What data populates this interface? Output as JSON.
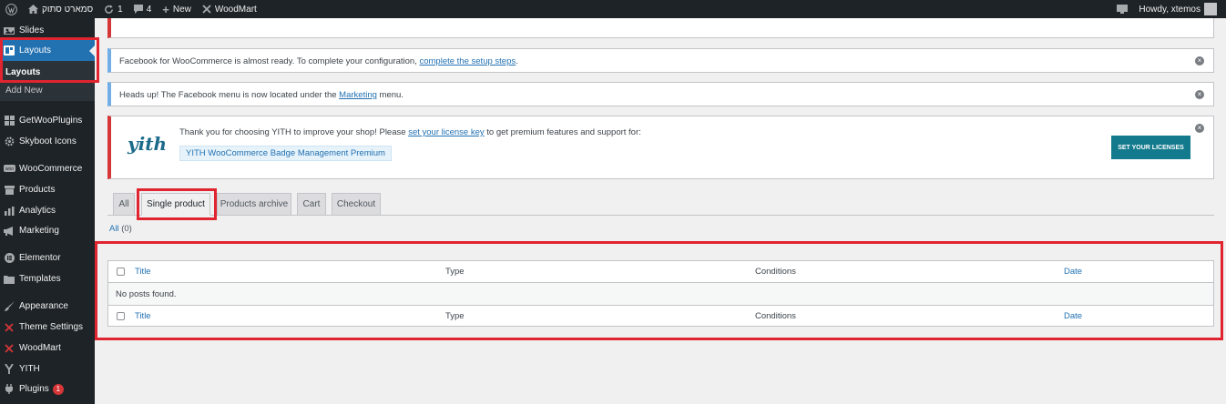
{
  "adminbar": {
    "site_name": "סמארט סתוק",
    "updates_count": "1",
    "comments_count": "4",
    "new_label": "New",
    "theme_label": "WoodMart",
    "greeting": "Howdy, xtemos"
  },
  "sidebar": {
    "items": [
      {
        "label": "Slides",
        "icon": "slides-icon"
      },
      {
        "label": "Layouts",
        "icon": "layouts-icon"
      },
      {
        "label": "GetWooPlugins",
        "icon": "plugin-grid-icon"
      },
      {
        "label": "Skyboot Icons",
        "icon": "gear-icon"
      },
      {
        "label": "WooCommerce",
        "icon": "woo-icon"
      },
      {
        "label": "Products",
        "icon": "archive-icon"
      },
      {
        "label": "Analytics",
        "icon": "chart-icon"
      },
      {
        "label": "Marketing",
        "icon": "megaphone-icon"
      },
      {
        "label": "Elementor",
        "icon": "elementor-icon"
      },
      {
        "label": "Templates",
        "icon": "folder-icon"
      },
      {
        "label": "Appearance",
        "icon": "paintbrush-icon"
      },
      {
        "label": "Theme Settings",
        "icon": "woodmart-icon"
      },
      {
        "label": "WoodMart",
        "icon": "woodmart-icon"
      },
      {
        "label": "YITH",
        "icon": "yith-icon"
      },
      {
        "label": "Plugins",
        "icon": "plug-icon"
      }
    ],
    "submenu": [
      "Layouts",
      "Add New"
    ],
    "plugins_badge": "1"
  },
  "notices": {
    "facebook_text": "Facebook for WooCommerce is almost ready. To complete your configuration,",
    "facebook_link": "complete the setup steps",
    "facebook_end": ".",
    "menu_text": "Heads up! The Facebook menu is now located under the",
    "menu_link": "Marketing",
    "menu_end": "menu.",
    "yith_text_1": "Thank you for choosing YITH to improve your shop! Please",
    "yith_link": "set your license key",
    "yith_text_2": "to get premium features and support for:",
    "yith_plugin": "YITH WooCommerce Badge Management Premium",
    "yith_button": "SET YOUR LICENSES",
    "yith_logo": "yith"
  },
  "tabs": [
    "All",
    "Single product",
    "Products archive",
    "Cart",
    "Checkout"
  ],
  "filter": {
    "link": "All",
    "count": "(0)"
  },
  "table": {
    "columns": [
      "Title",
      "Type",
      "Conditions",
      "Date"
    ],
    "empty": "No posts found."
  },
  "colors": {
    "accent": "#2271b1",
    "highlight": "#e02430",
    "sidebar": "#1d2327"
  }
}
